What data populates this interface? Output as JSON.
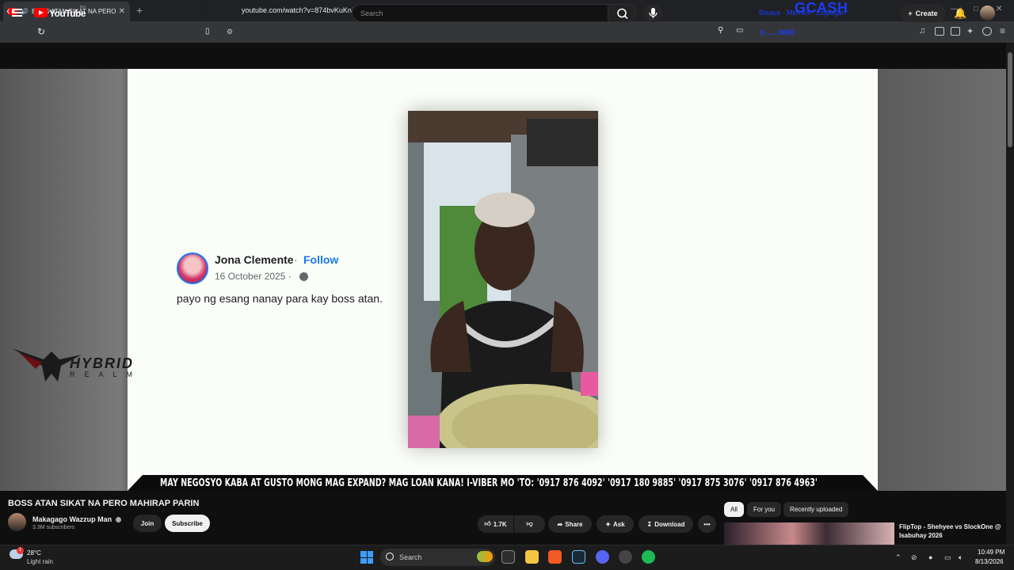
{
  "browser": {
    "tab_title": "BOSS ATAN SIKAT NA PERO MAHIRAP PARIN - YouTube",
    "url": "youtube.com/watch?v=874bvKuKnJ4",
    "overlay_brand": "GCASH",
    "overlay_number": "0……0000"
  },
  "youtube": {
    "brand": "YouTube",
    "country": "PH",
    "search_placeholder": "Search",
    "promo_text": "Bisaya · Memes · Loglogan",
    "create_label": "Create"
  },
  "video": {
    "fb_post": {
      "name": "Jona Clemente",
      "separator": "·",
      "follow": "Follow",
      "date": "16 October 2025 ·",
      "text": "payo ng esang nanay para kay boss atan."
    },
    "watermark": {
      "word": "HYBRID",
      "sub": "REALM"
    },
    "ticker": "MAY NEGOSYO KABA AT GUSTO MONG MAG EXPAND? MAG LOAN KANA! I-VIBER MO 'TO: '0917 876 4092' '0917 180 9885' '0917 875 3076' '0917 876 4963'"
  },
  "below_video": {
    "title": "BOSS ATAN SIKAT NA PERO MAHIRAP PARIN",
    "channel_name": "Makagago Wazzup Man",
    "subscribers": "3.3M subscribers",
    "join_label": "Join",
    "subscribe_label": "Subscribe",
    "likes": "1.7K",
    "share_label": "Share",
    "ask_label": "Ask",
    "download_label": "Download",
    "more_label": "•••"
  },
  "chips": [
    "All",
    "For you",
    "Recently uploaded"
  ],
  "recommended": {
    "title": "FlipTop - Shehyee vs SlockOne @ Isabuhay 2026"
  },
  "taskbar": {
    "temperature": "28°C",
    "condition": "Light rain",
    "weather_badge": "1",
    "search_label": "Search",
    "time": "10:49 PM",
    "date": "8/13/2026"
  },
  "colors": {
    "youtube_red": "#ff0000",
    "gcash_blue": "#1a3cff",
    "facebook_blue": "#1877f2"
  }
}
